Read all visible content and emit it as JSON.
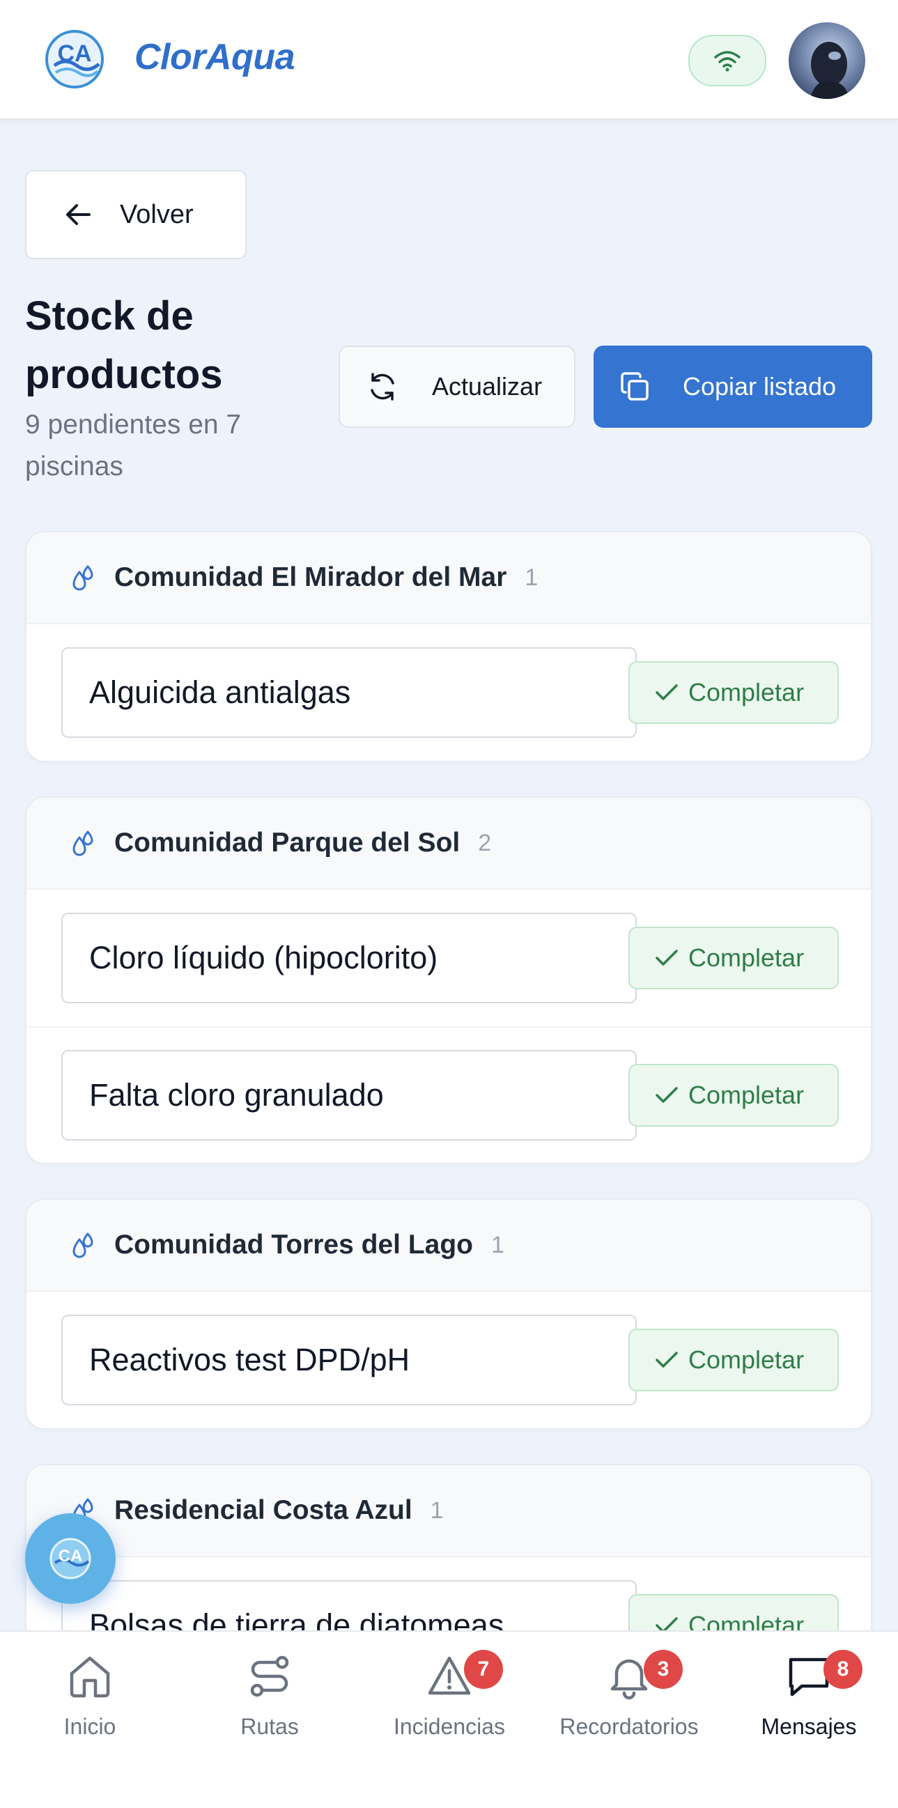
{
  "app": {
    "name": "ClorAqua",
    "logo_icon": "cloraqua-logo-icon"
  },
  "header": {
    "connection_icon": "wifi-icon",
    "avatar": "user-avatar"
  },
  "back_button": {
    "label": "Volver",
    "icon": "arrow-left-icon"
  },
  "page": {
    "title": "Stock de productos",
    "subtitle": "9 pendientes en 7 piscinas"
  },
  "actions": {
    "refresh_label": "Actualizar",
    "refresh_icon": "refresh-icon",
    "copy_label": "Copiar listado",
    "copy_icon": "copy-icon"
  },
  "groups": [
    {
      "name": "Comunidad El Mirador del Mar",
      "count": "1",
      "items": [
        {
          "value": "Alguicida antialgas",
          "action": "Completar"
        }
      ]
    },
    {
      "name": "Comunidad Parque del Sol",
      "count": "2",
      "items": [
        {
          "value": "Cloro líquido (hipoclorito)",
          "action": "Completar"
        },
        {
          "value": "Falta cloro granulado",
          "action": "Completar"
        }
      ]
    },
    {
      "name": "Comunidad Torres del Lago",
      "count": "1",
      "items": [
        {
          "value": "Reactivos test DPD/pH",
          "action": "Completar"
        }
      ]
    },
    {
      "name": "Residencial Costa Azul",
      "count": "1",
      "items": [
        {
          "value": "Bolsas de tierra de diatomeas",
          "action": "Completar"
        }
      ]
    }
  ],
  "bottom_nav": [
    {
      "label": "Inicio",
      "icon": "home-icon",
      "badge": null,
      "active": false
    },
    {
      "label": "Rutas",
      "icon": "route-icon",
      "badge": null,
      "active": false
    },
    {
      "label": "Incidencias",
      "icon": "warning-icon",
      "badge": "7",
      "active": false
    },
    {
      "label": "Recordatorios",
      "icon": "bell-icon",
      "badge": "3",
      "active": false
    },
    {
      "label": "Mensajes",
      "icon": "chat-icon",
      "badge": "8",
      "active": true
    }
  ],
  "colors": {
    "brand": "#2f6fca",
    "primary_button": "#3574d0",
    "success": "#2f7d48",
    "badge": "#e04848",
    "background": "#eef3fb"
  }
}
